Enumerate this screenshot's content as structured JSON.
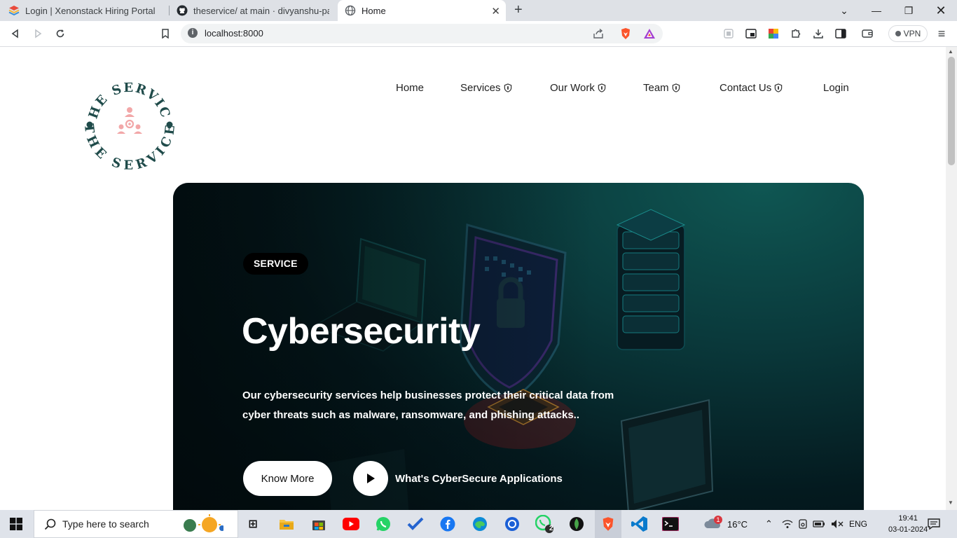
{
  "browser": {
    "tabs": [
      {
        "title": "Login | Xenonstack Hiring Portal",
        "active": false
      },
      {
        "title": "theservice/ at main · divyanshu-pal/th",
        "active": false
      },
      {
        "title": "Home",
        "active": true
      }
    ],
    "url": "localhost:8000",
    "vpn_label": "VPN"
  },
  "site": {
    "logo_text_top": "THE SERVICE",
    "logo_text_bottom": "THE SERVICE",
    "nav": [
      {
        "label": "Home",
        "has_icon": false
      },
      {
        "label": "Services",
        "has_icon": true
      },
      {
        "label": "Our Work",
        "has_icon": true
      },
      {
        "label": "Team",
        "has_icon": true
      },
      {
        "label": "Contact Us",
        "has_icon": true
      },
      {
        "label": "Login",
        "has_icon": false
      }
    ]
  },
  "hero": {
    "badge": "SERVICE",
    "title": "Cybersecurity",
    "description": "Our cybersecurity services help businesses protect their critical data from cyber threats such as malware, ransomware, and phishing attacks..",
    "primary_button": "Know More",
    "video_link": "What's CyberSecure Applications"
  },
  "taskbar": {
    "search_placeholder": "Type here to search",
    "whatsapp_badge": "2",
    "weather": "16°C",
    "language": "ENG",
    "time": "19:41",
    "date": "03-01-2024",
    "notification_badge": "1"
  },
  "colors": {
    "logo_teal": "#1f4b4a",
    "logo_pink": "#f2a7a8",
    "hero_teal": "#0f5753"
  }
}
